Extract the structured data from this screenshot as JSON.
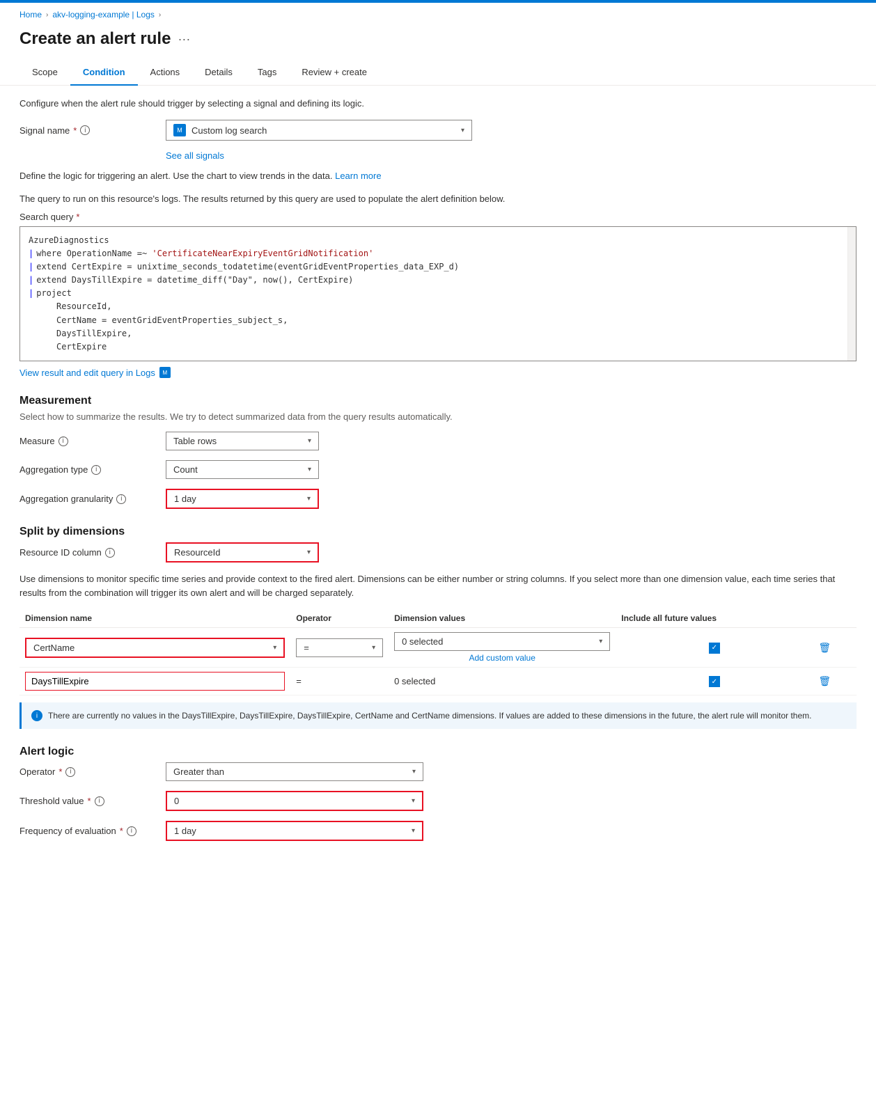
{
  "topbar": {
    "color": "#0078d4"
  },
  "breadcrumb": {
    "items": [
      {
        "label": "Home",
        "link": true
      },
      {
        "label": "akv-logging-example | Logs",
        "link": true
      }
    ],
    "separator": ">"
  },
  "pageHeader": {
    "title": "Create an alert rule",
    "moreIcon": "···"
  },
  "tabs": [
    {
      "label": "Scope",
      "active": false
    },
    {
      "label": "Condition",
      "active": true
    },
    {
      "label": "Actions",
      "active": false
    },
    {
      "label": "Details",
      "active": false
    },
    {
      "label": "Tags",
      "active": false
    },
    {
      "label": "Review + create",
      "active": false
    }
  ],
  "condition": {
    "description": "Configure when the alert rule should trigger by selecting a signal and defining its logic.",
    "signalName": {
      "label": "Signal name",
      "required": true,
      "value": "Custom log search",
      "seeAllLink": "See all signals"
    },
    "defineLogicDesc": "Define the logic for triggering an alert. Use the chart to view trends in the data.",
    "learnMore": "Learn more",
    "queryDesc": "The query to run on this resource's logs. The results returned by this query are used to populate the alert definition below.",
    "searchQuery": {
      "label": "Search query",
      "required": true,
      "lines": [
        {
          "type": "plain",
          "text": "AzureDiagnostics"
        },
        {
          "type": "pipe",
          "text": "| where OperationName =~ 'CertificateNearExpiryEventGridNotification'"
        },
        {
          "type": "pipe",
          "text": "| extend CertExpire = unixtime_seconds_todatetime(eventGridEventProperties_data_EXP_d)"
        },
        {
          "type": "pipe",
          "text": "| extend DaysTillExpire = datetime_diff(\"Day\", now(), CertExpire)"
        },
        {
          "type": "pipe",
          "text": "| project"
        },
        {
          "type": "indent",
          "text": "ResourceId,"
        },
        {
          "type": "indent",
          "text": "CertName = eventGridEventProperties_subject_s,"
        },
        {
          "type": "indent",
          "text": "DaysTillExpire,"
        },
        {
          "type": "indent",
          "text": "CertExpire"
        }
      ]
    },
    "viewLink": "View result and edit query in Logs"
  },
  "measurement": {
    "title": "Measurement",
    "description": "Select how to summarize the results. We try to detect summarized data from the query results automatically.",
    "measure": {
      "label": "Measure",
      "value": "Table rows"
    },
    "aggregationType": {
      "label": "Aggregation type",
      "value": "Count"
    },
    "aggregationGranularity": {
      "label": "Aggregation granularity",
      "value": "1 day",
      "highlighted": true
    }
  },
  "splitByDimensions": {
    "title": "Split by dimensions",
    "resourceIdColumn": {
      "label": "Resource ID column",
      "value": "ResourceId",
      "highlighted": true
    },
    "infoText": "Use dimensions to monitor specific time series and provide context to the fired alert. Dimensions can be either number or string columns. If you select more than one dimension value, each time series that results from the combination will trigger its own alert and will be charged separately.",
    "tableHeaders": [
      "Dimension name",
      "Operator",
      "Dimension values",
      "Include all future values"
    ],
    "rows": [
      {
        "dimensionName": "CertName",
        "operator": "=",
        "dimensionValues": "0 selected",
        "includeAllFuture": true,
        "highlighted": true,
        "hasAddCustom": true
      },
      {
        "dimensionName": "DaysTillExpire",
        "operator": "=",
        "dimensionValues": "0 selected",
        "includeAllFuture": true,
        "highlighted": true,
        "hasAddCustom": false
      }
    ],
    "infoBoxText": "There are currently no values in the DaysTillExpire, DaysTillExpire, DaysTillExpire, CertName and CertName dimensions. If values are added to these dimensions in the future, the alert rule will monitor them."
  },
  "alertLogic": {
    "title": "Alert logic",
    "operator": {
      "label": "Operator",
      "required": true,
      "value": "Greater than"
    },
    "thresholdValue": {
      "label": "Threshold value",
      "required": true,
      "value": "0",
      "highlighted": true
    },
    "frequencyOfEvaluation": {
      "label": "Frequency of evaluation",
      "required": true,
      "value": "1 day",
      "highlighted": true
    }
  }
}
